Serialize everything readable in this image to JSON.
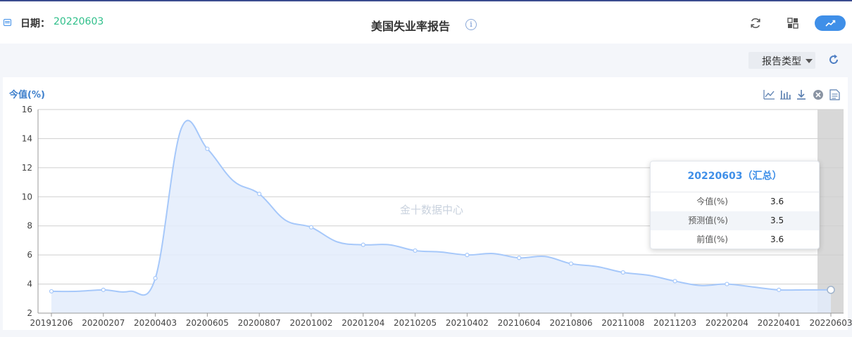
{
  "header": {
    "date_label": "日期：",
    "date_value": "20220603",
    "title": "美国失业率报告",
    "info_glyph": "i",
    "icons": [
      "calendar-icon",
      "info-icon",
      "refresh-icon",
      "grid-icon",
      "chart-icon"
    ]
  },
  "toolbar": {
    "report_type_label": "报告类型",
    "icons": [
      "caret-down-icon",
      "refresh-icon"
    ]
  },
  "chart_tools": [
    "line-chart-icon",
    "bar-chart-icon",
    "download-icon",
    "close-icon",
    "data-view-icon"
  ],
  "watermark": "金十数据中心",
  "colors": {
    "accent": "#3f8fe8",
    "date_value": "#2fbf8a",
    "line": "#a6c8fa",
    "area": "#e3ecfc",
    "highlight_band": "#d6d6d6"
  },
  "chart_data": {
    "type": "area",
    "y_axis_label": "今值(%)",
    "ylim": [
      2,
      16
    ],
    "yticks": [
      2,
      4,
      6,
      8,
      10,
      12,
      14,
      16
    ],
    "grid": true,
    "x_tick_labels": [
      "20191206",
      "20200207",
      "20200403",
      "20200605",
      "20200807",
      "20201002",
      "20201204",
      "20210205",
      "20210402",
      "20210604",
      "20210806",
      "20211008",
      "20211203",
      "20220204",
      "20220401",
      "20220603"
    ],
    "x": [
      "20191206",
      "20200110",
      "20200207",
      "20200306",
      "20200403",
      "20200508",
      "20200605",
      "20200702",
      "20200807",
      "20200904",
      "20201002",
      "20201106",
      "20201204",
      "20210108",
      "20210205",
      "20210305",
      "20210402",
      "20210507",
      "20210604",
      "20210702",
      "20210806",
      "20210903",
      "20211008",
      "20211105",
      "20211203",
      "20220107",
      "20220204",
      "20220304",
      "20220401",
      "20220506",
      "20220603"
    ],
    "series": [
      {
        "values": [
          3.5,
          3.5,
          3.6,
          3.5,
          4.4,
          14.7,
          13.3,
          11.1,
          10.2,
          8.4,
          7.9,
          6.9,
          6.7,
          6.7,
          6.3,
          6.2,
          6.0,
          6.1,
          5.8,
          5.9,
          5.4,
          5.2,
          4.8,
          4.6,
          4.2,
          3.9,
          4.0,
          3.8,
          3.6,
          3.6,
          3.6
        ]
      }
    ],
    "marked_points": [
      0,
      2,
      4,
      6,
      8,
      10,
      12,
      14,
      16,
      18,
      20,
      22,
      24,
      26,
      28
    ],
    "highlight_index": 30,
    "tooltip": {
      "title": "20220603（汇总）",
      "rows": [
        {
          "label": "今值(%)",
          "value": "3.6"
        },
        {
          "label": "预测值(%)",
          "value": "3.5"
        },
        {
          "label": "前值(%)",
          "value": "3.6"
        }
      ]
    }
  }
}
